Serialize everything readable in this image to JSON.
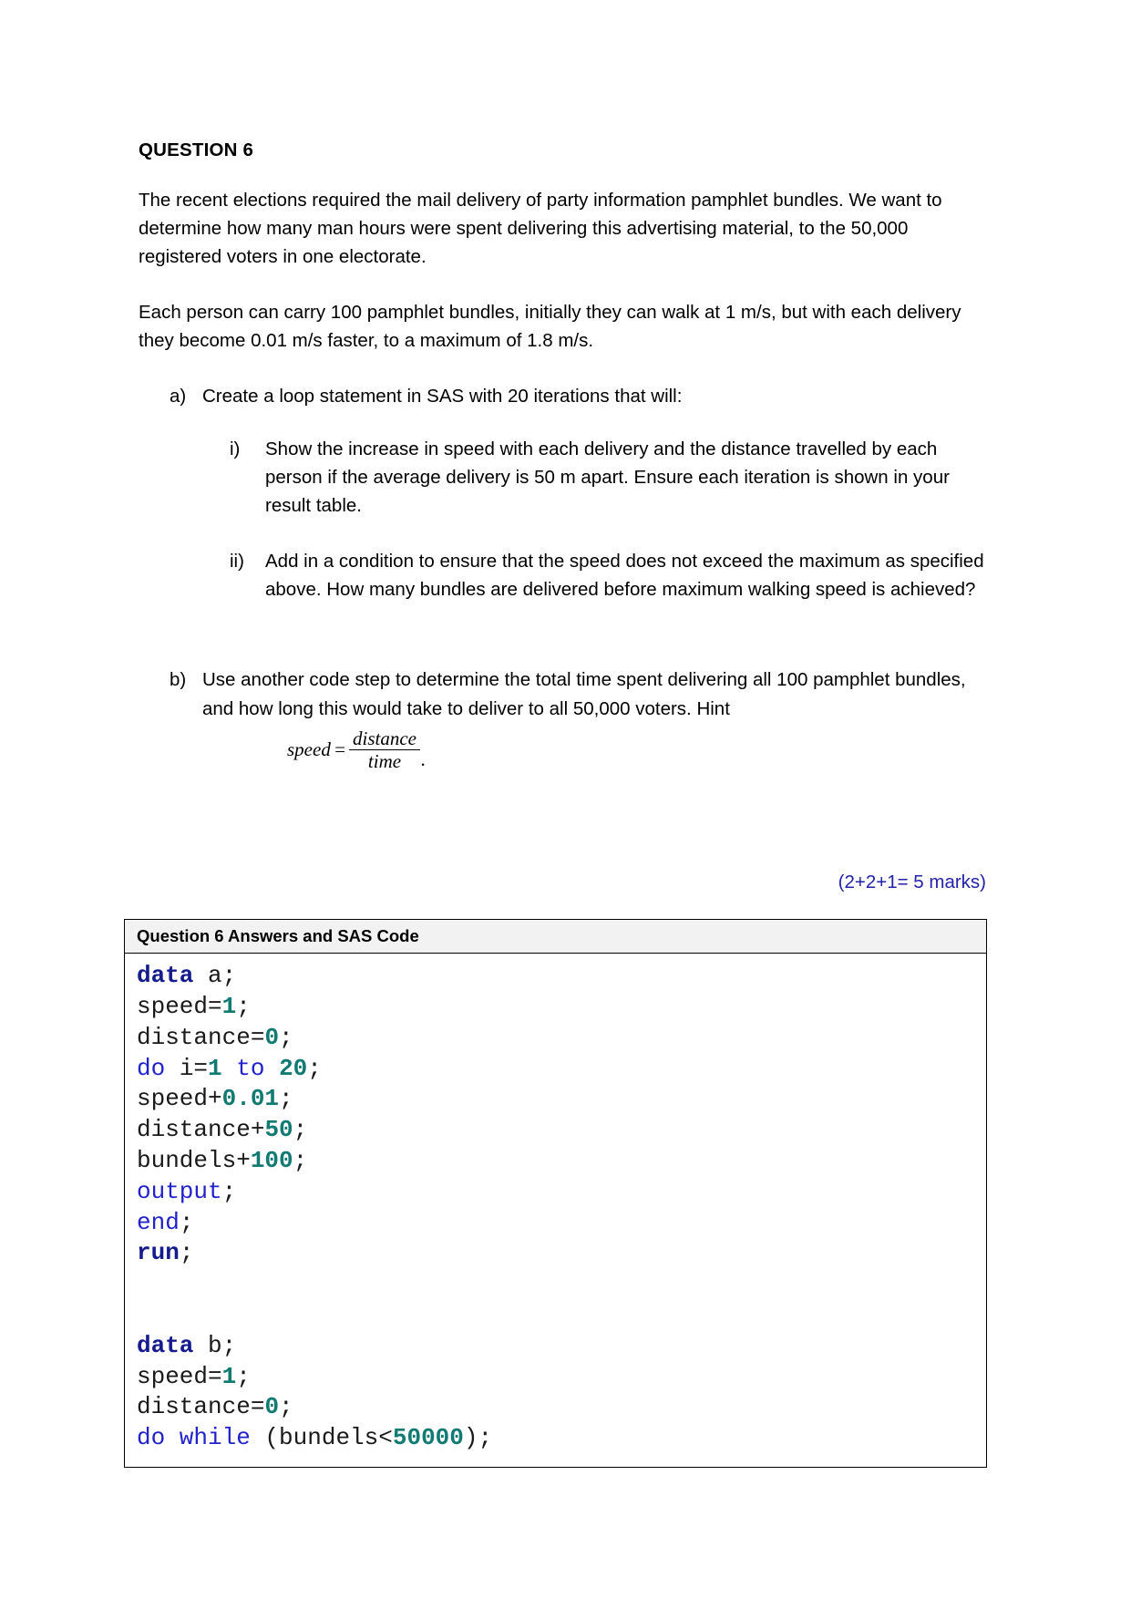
{
  "document": {
    "title": "QUESTION 6",
    "paragraphs": [
      "The recent elections required the mail delivery of party information pamphlet bundles. We want to determine how many man hours were spent delivering this advertising material, to the 50,000 registered voters in one electorate.",
      "Each person can carry 100 pamphlet bundles, initially they can walk at 1 m/s, but with each delivery they become 0.01 m/s faster, to a maximum of 1.8 m/s."
    ],
    "questions": [
      {
        "marker": "a)",
        "text": "Create a loop statement in SAS with 20 iterations that will:",
        "subitems": [
          {
            "marker": "i)",
            "text": "Show the increase in speed with each delivery and the distance travelled by each person if the average delivery is 50 m apart. Ensure each iteration is shown in your result table."
          },
          {
            "marker": "ii)",
            "text": "Add in a condition to ensure that the speed does not exceed the maximum as specified above. How many bundles are delivered before maximum walking speed is achieved?"
          }
        ]
      },
      {
        "marker": "b)",
        "text": "Use another code step to determine the total time spent delivering all 100 pamphlet bundles, and how long this would take to deliver to all 50,000 voters. Hint",
        "subitems": []
      }
    ],
    "formula": {
      "lhs": "speed",
      "equals": "=",
      "numerator": "distance",
      "denominator": "time",
      "trailing": "."
    },
    "marks": "(2+2+1= 5 marks)",
    "marks_color": "#2222aa",
    "answer_table": {
      "header": "Question 6 Answers and SAS Code",
      "header_bg": "#f2f2f2",
      "code_lines": [
        [
          {
            "t": "data",
            "c": "bold"
          },
          {
            "t": " a;",
            "c": "plain"
          }
        ],
        [
          {
            "t": "speed=",
            "c": "plain"
          },
          {
            "t": "1",
            "c": "num"
          },
          {
            "t": ";",
            "c": "plain"
          }
        ],
        [
          {
            "t": "distance=",
            "c": "plain"
          },
          {
            "t": "0",
            "c": "num"
          },
          {
            "t": ";",
            "c": "plain"
          }
        ],
        [
          {
            "t": "do",
            "c": "blue"
          },
          {
            "t": " i=",
            "c": "plain"
          },
          {
            "t": "1",
            "c": "num"
          },
          {
            "t": " ",
            "c": "plain"
          },
          {
            "t": "to",
            "c": "blue"
          },
          {
            "t": " ",
            "c": "plain"
          },
          {
            "t": "20",
            "c": "num"
          },
          {
            "t": ";",
            "c": "plain"
          }
        ],
        [
          {
            "t": "speed+",
            "c": "plain"
          },
          {
            "t": "0.01",
            "c": "num"
          },
          {
            "t": ";",
            "c": "plain"
          }
        ],
        [
          {
            "t": "distance+",
            "c": "plain"
          },
          {
            "t": "50",
            "c": "num"
          },
          {
            "t": ";",
            "c": "plain"
          }
        ],
        [
          {
            "t": "bundels+",
            "c": "plain"
          },
          {
            "t": "100",
            "c": "num"
          },
          {
            "t": ";",
            "c": "plain"
          }
        ],
        [
          {
            "t": "output",
            "c": "blue"
          },
          {
            "t": ";",
            "c": "plain"
          }
        ],
        [
          {
            "t": "end",
            "c": "blue"
          },
          {
            "t": ";",
            "c": "plain"
          }
        ],
        [
          {
            "t": "run",
            "c": "bold"
          },
          {
            "t": ";",
            "c": "plain"
          }
        ],
        [],
        [],
        [
          {
            "t": "data",
            "c": "bold"
          },
          {
            "t": " b;",
            "c": "plain"
          }
        ],
        [
          {
            "t": "speed=",
            "c": "plain"
          },
          {
            "t": "1",
            "c": "num"
          },
          {
            "t": ";",
            "c": "plain"
          }
        ],
        [
          {
            "t": "distance=",
            "c": "plain"
          },
          {
            "t": "0",
            "c": "num"
          },
          {
            "t": ";",
            "c": "plain"
          }
        ],
        [
          {
            "t": "do while",
            "c": "blue"
          },
          {
            "t": " (bundels<",
            "c": "plain"
          },
          {
            "t": "50000",
            "c": "num"
          },
          {
            "t": ");",
            "c": "plain"
          }
        ]
      ]
    }
  }
}
